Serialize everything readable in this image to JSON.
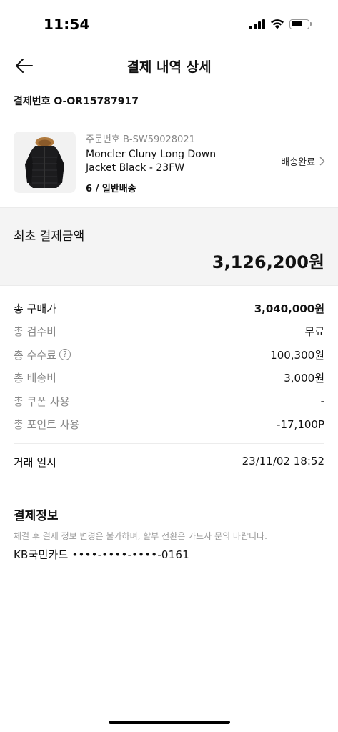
{
  "status_bar": {
    "time": "11:54",
    "battery_level": 0.7
  },
  "header": {
    "title": "결제 내역 상세",
    "back_icon": "arrow-left-icon"
  },
  "payment_number": "결제번호 O-OR15787917",
  "product": {
    "order_number": "주문번호 B-SW59028021",
    "name": "Moncler Cluny Long Down Jacket Black - 23FW",
    "meta": "6 / 일반배송",
    "status": "배송완료",
    "status_icon": "chevron-right-icon"
  },
  "total": {
    "label": "최초 결제금액",
    "value": "3,126,200원"
  },
  "breakdown": [
    {
      "label": "총 구매가",
      "value": "3,040,000원"
    },
    {
      "label": "총 검수비",
      "value": "무료"
    },
    {
      "label": "총 수수료",
      "value": "100,300원",
      "help_icon": "question-circle-icon"
    },
    {
      "label": "총 배송비",
      "value": "3,000원"
    },
    {
      "label": "총 쿠폰 사용",
      "value": "-"
    },
    {
      "label": "총 포인트 사용",
      "value": "-17,100P"
    }
  ],
  "transaction": {
    "label": "거래 일시",
    "value": "23/11/02 18:52"
  },
  "payment_info": {
    "title": "결제정보",
    "note": "체결 후 결제 정보 변경은 불가하며, 할부 전환은 카드사 문의 바랍니다.",
    "card": "KB국민카드 ••••-••••-••••-0161"
  },
  "colors": {
    "total_background": "#f4f4f4",
    "muted_text": "#888888"
  }
}
